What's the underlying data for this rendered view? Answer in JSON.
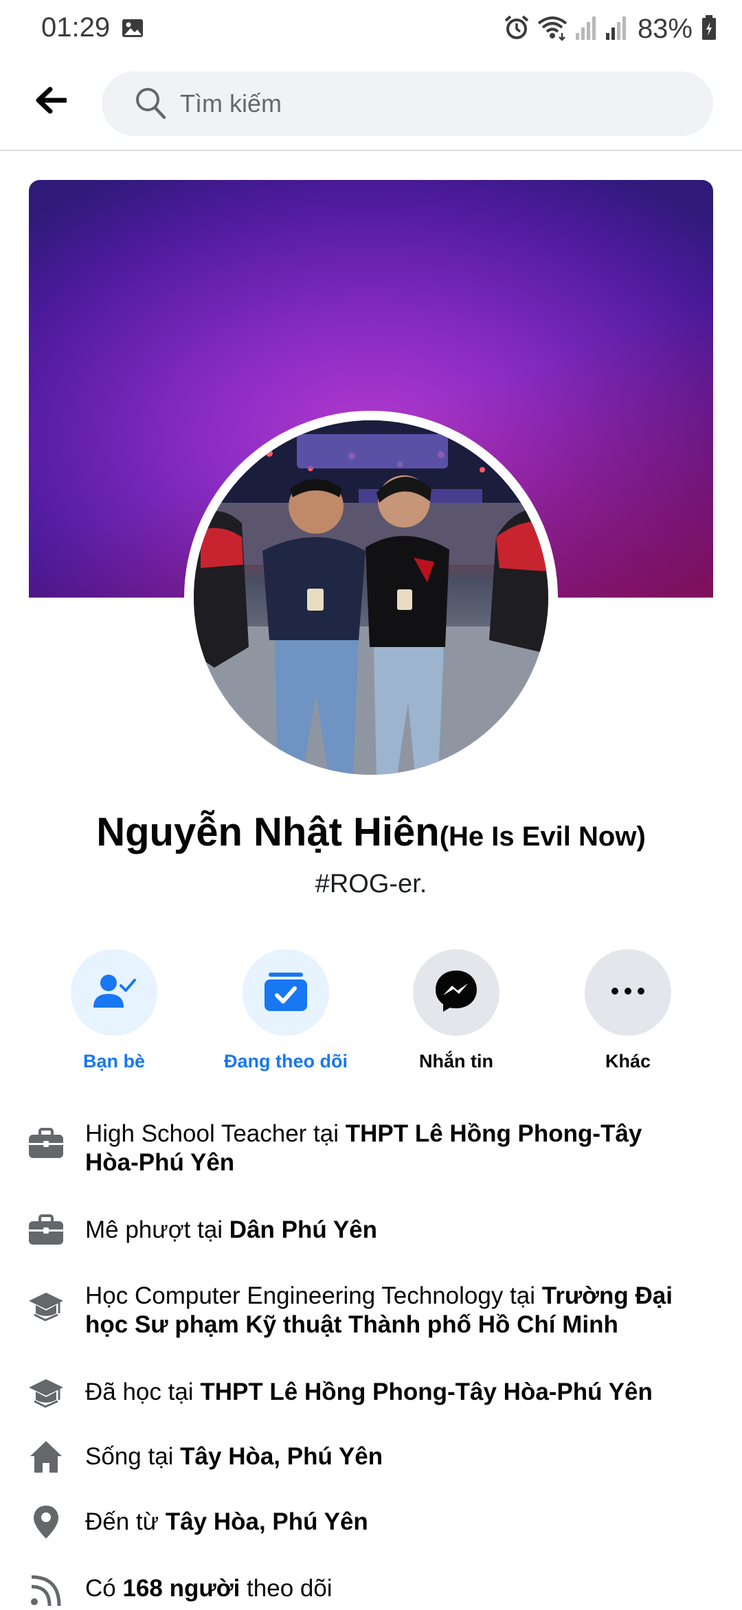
{
  "status_bar": {
    "time": "01:29",
    "battery": "83%",
    "icons": [
      "image-icon",
      "alarm-icon",
      "wifi-icon",
      "signal-icon",
      "signal-icon",
      "battery-charging-icon"
    ]
  },
  "search": {
    "placeholder": "Tìm kiếm"
  },
  "profile": {
    "name": "Nguyễn Nhật Hiên",
    "alternate_name": "(He Is Evil Now)",
    "bio": "#ROG-er."
  },
  "actions": [
    {
      "label": "Bạn bè",
      "icon": "friends-check-icon"
    },
    {
      "label": "Đang theo dõi",
      "icon": "following-icon"
    },
    {
      "label": "Nhắn tin",
      "icon": "messenger-icon"
    },
    {
      "label": "Khác",
      "icon": "more-icon"
    }
  ],
  "details": [
    {
      "icon": "briefcase-icon",
      "prefix": "High School Teacher tại ",
      "bold": "THPT Lê Hồng Phong-Tây Hòa-Phú Yên",
      "suffix": ""
    },
    {
      "icon": "briefcase-icon",
      "prefix": "Mê phượt tại ",
      "bold": "Dân Phú Yên",
      "suffix": ""
    },
    {
      "icon": "graduation-cap-icon",
      "prefix": "Học Computer Engineering Technology tại ",
      "bold": "Trường Đại học Sư phạm Kỹ thuật Thành phố Hồ Chí Minh",
      "suffix": ""
    },
    {
      "icon": "graduation-cap-icon",
      "prefix": "Đã học tại ",
      "bold": "THPT Lê Hồng Phong-Tây Hòa-Phú Yên",
      "suffix": ""
    },
    {
      "icon": "home-icon",
      "prefix": "Sống tại ",
      "bold": "Tây Hòa, Phú Yên",
      "suffix": ""
    },
    {
      "icon": "location-pin-icon",
      "prefix": "Đến từ ",
      "bold": "Tây Hòa, Phú Yên",
      "suffix": ""
    },
    {
      "icon": "rss-followers-icon",
      "prefix": "Có ",
      "bold": "168 người",
      "suffix": " theo dõi"
    }
  ],
  "colors": {
    "accent": "#1877f2",
    "accent_light_bg": "#e7f3ff",
    "grey_button_bg": "#e4e6eb",
    "icon_grey": "#65676b"
  }
}
